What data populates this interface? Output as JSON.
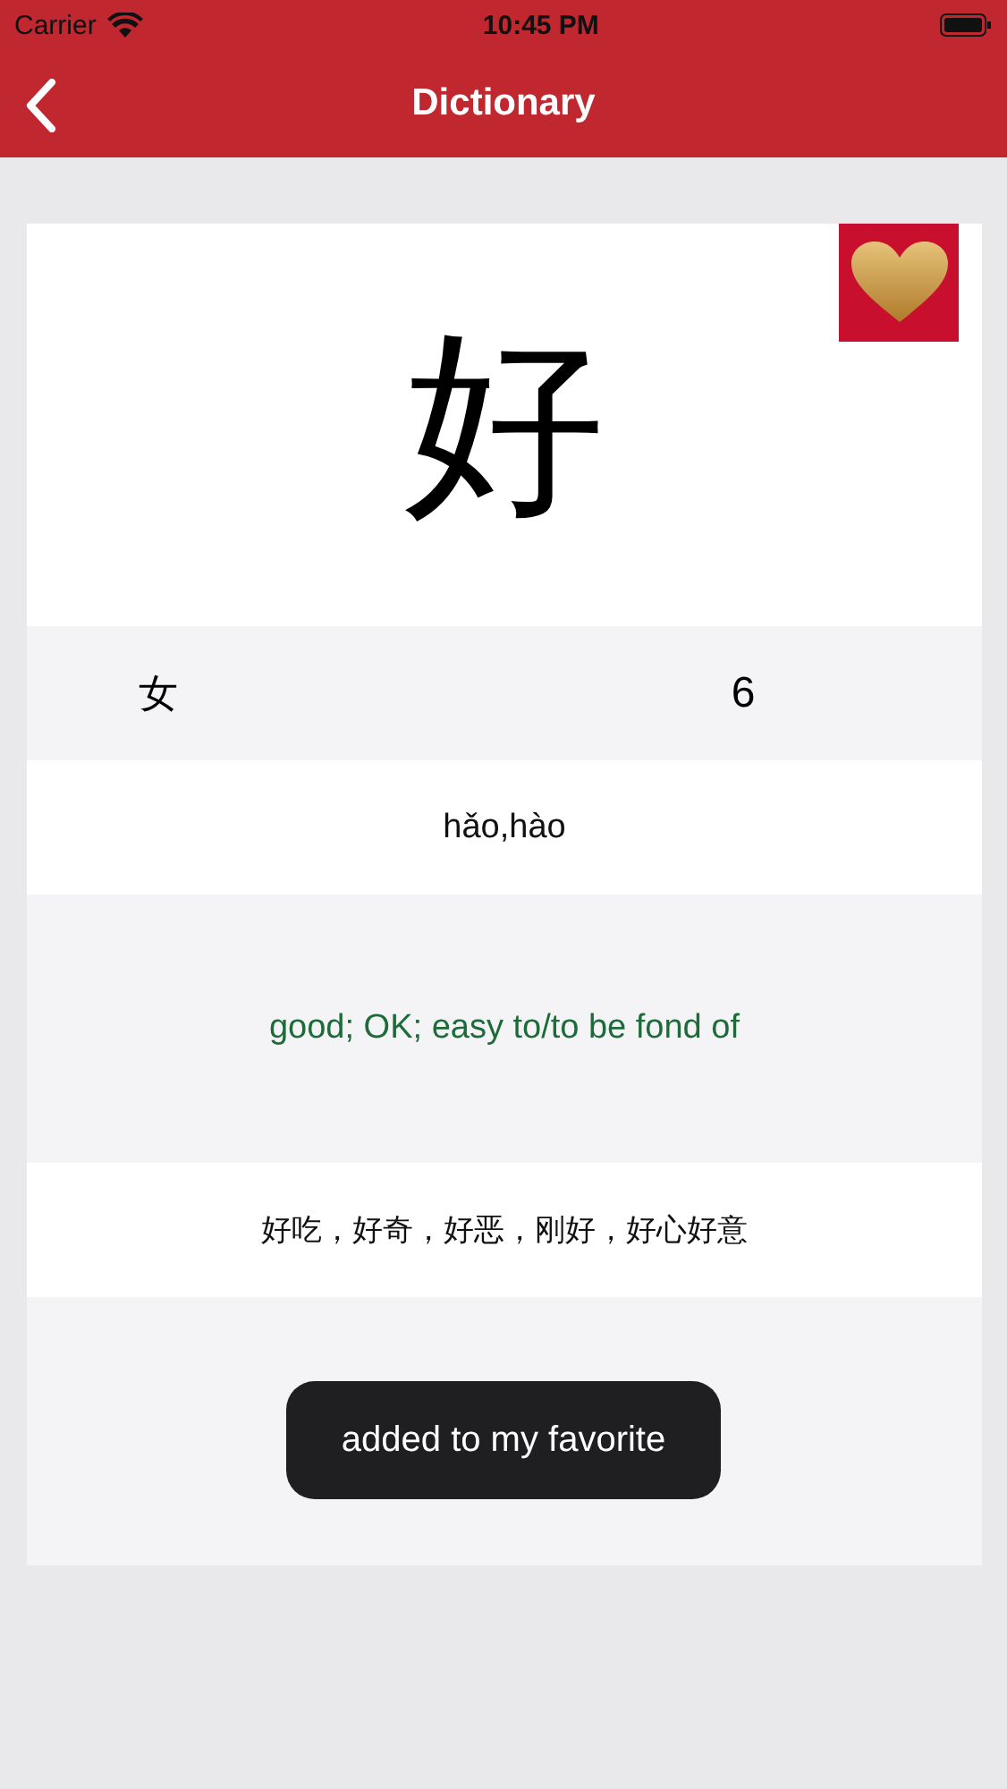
{
  "status_bar": {
    "carrier": "Carrier",
    "time": "10:45 PM"
  },
  "nav": {
    "title": "Dictionary"
  },
  "entry": {
    "character": "好",
    "favorite": true,
    "radical": "女",
    "strokes": "6",
    "pinyin": "hǎo,hào",
    "meaning": "good; OK; easy to/to be fond of",
    "words": "好吃，好奇，好恶，刚好，好心好意"
  },
  "toast": {
    "message": "added to my favorite"
  }
}
